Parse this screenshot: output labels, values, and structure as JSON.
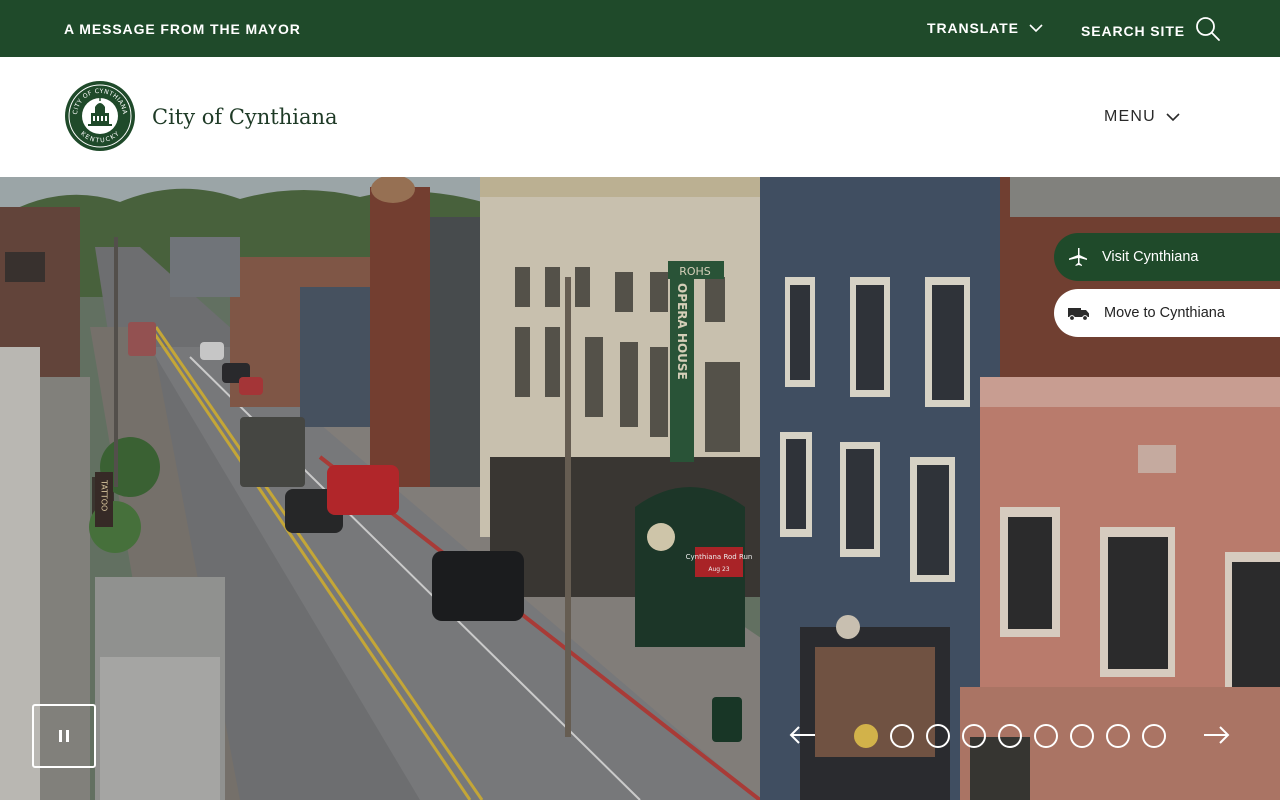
{
  "topbar": {
    "mayor_label": "A MESSAGE FROM THE MAYOR",
    "translate_label": "TRANSLATE",
    "search_label": "SEARCH SITE",
    "background": "#1f4a2a"
  },
  "header": {
    "site_title": "City of Cynthiana",
    "logo_text_top": "CITY OF CYNTHIANA",
    "logo_text_bottom": "KENTUCKY",
    "menu_label": "MENU"
  },
  "hero": {
    "quick_links": [
      {
        "label": "Visit Cynthiana",
        "icon": "airplane-icon"
      },
      {
        "label": "Move to Cynthiana",
        "icon": "moving-truck-icon"
      }
    ],
    "slides_total": 9,
    "active_slide": 1,
    "accent_color": "#d2b24a",
    "storefront_signs": {
      "vertical_sign": "OPERA HOUSE",
      "vertical_sign_top": "ROHS",
      "marquee": "Cynthiana Rod Run",
      "marquee_date": "Aug 23",
      "side_sign": "TATTOO"
    }
  }
}
